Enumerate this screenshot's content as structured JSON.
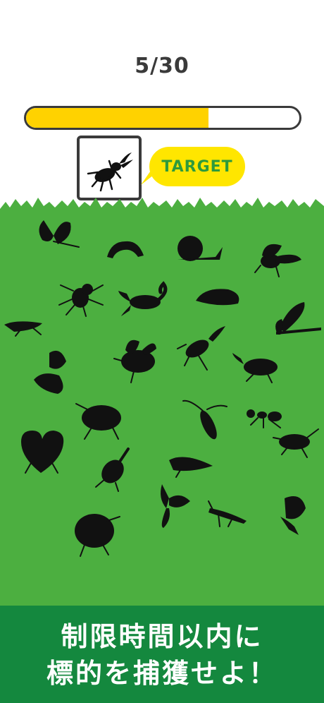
{
  "progress": {
    "label": "5/30",
    "fraction": 0.667
  },
  "target": {
    "icon": "stag-beetle-icon",
    "bubble_text": "TARGET"
  },
  "field_bugs": [
    "butterfly",
    "caterpillar",
    "snail",
    "fly",
    "spider",
    "scorpion",
    "slug",
    "grasshopper",
    "dragonfly",
    "bee",
    "stag-beetle",
    "rhinoceros-beetle",
    "moth",
    "dung-beetle",
    "longhorn-beetle",
    "ant",
    "heart-shaped-bug",
    "rhinoceros-beetle-small",
    "cicada",
    "aphid",
    "butterfly-small",
    "mantis",
    "swallowtail",
    "pill-bug"
  ],
  "banner": {
    "line1": "制限時間以内に",
    "line2": "標的を捕獲せよ！"
  },
  "colors": {
    "grass": "#4caf40",
    "progress": "#ffd200",
    "bubble": "#ffe600",
    "banner": "#14883e"
  }
}
